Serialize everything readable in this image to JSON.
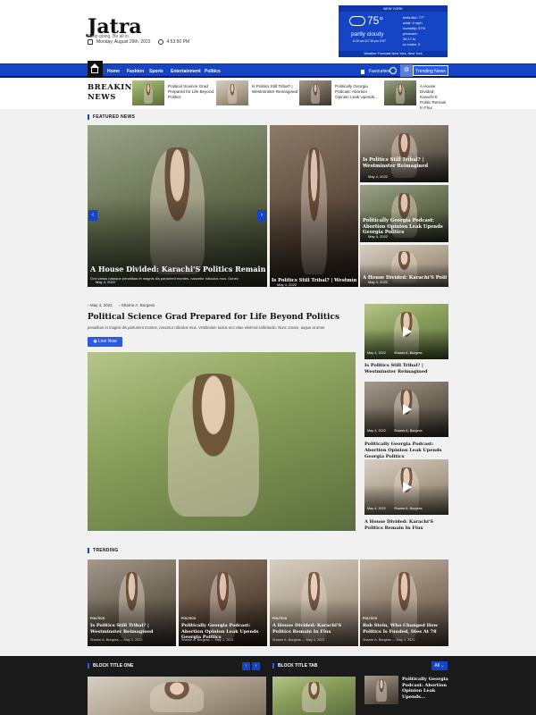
{
  "site": {
    "name": "Jatra",
    "tagline": "Keep going. Be all in.",
    "date": "Monday, August 29th, 2022",
    "time": "4:53:50 PM"
  },
  "weather": {
    "city": "NEW YORK",
    "temp": "75°",
    "condition": "partly cloudy",
    "minmax": "6.26 am 6:7.30 pm EST",
    "stats": [
      "feels like: 77°",
      "wind: 4 mph",
      "humidity: 57%",
      "pressure:",
      "30.17 in",
      "uv index: 0"
    ],
    "footer": "Weather Forecast New York, New York"
  },
  "nav": {
    "links": [
      "Home",
      "Fashion",
      "Sports",
      "Entertainment",
      "Politics"
    ],
    "favorites": "Favourites",
    "trending": "Trending News"
  },
  "breaking": {
    "label_1": "BREAKING",
    "label_2": "NEWS",
    "items": [
      "Political Science Grad Prepared for Life Beyond Politics",
      "Is Politics Still Tribal? | Westminster Reimagined",
      "Politically Georgia Podcast: Abortion Opinion Leak Upends...",
      "A House Divided: Karachi'S Politic Remain In Flux"
    ]
  },
  "featured": {
    "heading": "FEATURED NEWS",
    "main_title": "A House Divided: Karachi'S Politics Remain In Flux",
    "main_excerpt": "Orci varius natoque penatibus et magnis dis parturient montes, nascetur ridiculus mus. Donec",
    "main_date": "May 4, 2022",
    "middle_title": "Is Politics Still Tribal? | Westminster Reimagined",
    "middle_date": "May 4, 2022",
    "side": [
      {
        "title": "Is Politics Still Tribal? | Westminster Reimagined",
        "date": "May 4, 2022"
      },
      {
        "title": "Politically Georgia Podcast: Abortion Opinion Leak Upends Georgia Politics",
        "date": "May 4, 2022"
      },
      {
        "title": "A House Divided: Karachi'S Politics Remain In Flux",
        "date": "May 4, 2022"
      }
    ]
  },
  "article": {
    "date": "May 4, 2022",
    "author": "Sharne A. Burgess",
    "title": "Political Science Grad Prepared for Life Beyond Politics",
    "excerpt": "penatibus et magnis dis parturient montes, nascetur ridiculus mus. Vestibulum luctus orci vitae eleifend sollicitudin. Nunc ornare, augue at amet",
    "live": "Live Now",
    "side": [
      {
        "title": "Is Politics Still Tribal? | Westminster Reimagined",
        "date": "May 4, 2022",
        "author": "Sharne A. Burgess"
      },
      {
        "title": "Politically Georgia Podcast: Abortion Opinion Leak Upends Georgia Politics",
        "date": "May 4, 2022",
        "author": "Sharne A. Burgess"
      },
      {
        "title": "A House Divided: Karachi'S Politics Remain In Flux",
        "date": "May 4, 2022",
        "author": "Sharne A. Burgess"
      }
    ]
  },
  "trending": {
    "heading": "TRENDING",
    "items": [
      {
        "cat": "POLITICS",
        "title": "Is Politics Still Tribal? | Westminster Reimagined",
        "meta": "Sharne A. Burgess — May 4, 2022"
      },
      {
        "cat": "POLITICS",
        "title": "Politically Georgia Podcast: Abortion Opinion Leak Upends Georgia Politics",
        "meta": "Sharne A. Burgess — May 4, 2022"
      },
      {
        "cat": "POLITICS",
        "title": "A House Divided: Karachi'S Politics Remain In Flux",
        "meta": "Sharne A. Burgess — May 4, 2022"
      },
      {
        "cat": "POLITICS",
        "title": "Rob Stein, Who Changed How Politics Is Funded, Dies At 78",
        "meta": "Sharne A. Burgess — May 4, 2022"
      }
    ]
  },
  "blocks": {
    "one": "BLOCK TITLE ONE",
    "tab": "BLOCK TITLE TAB",
    "all": "All",
    "tab_item": "Politically Georgia Podcast: Abortion Opinion Leak Upends..."
  }
}
